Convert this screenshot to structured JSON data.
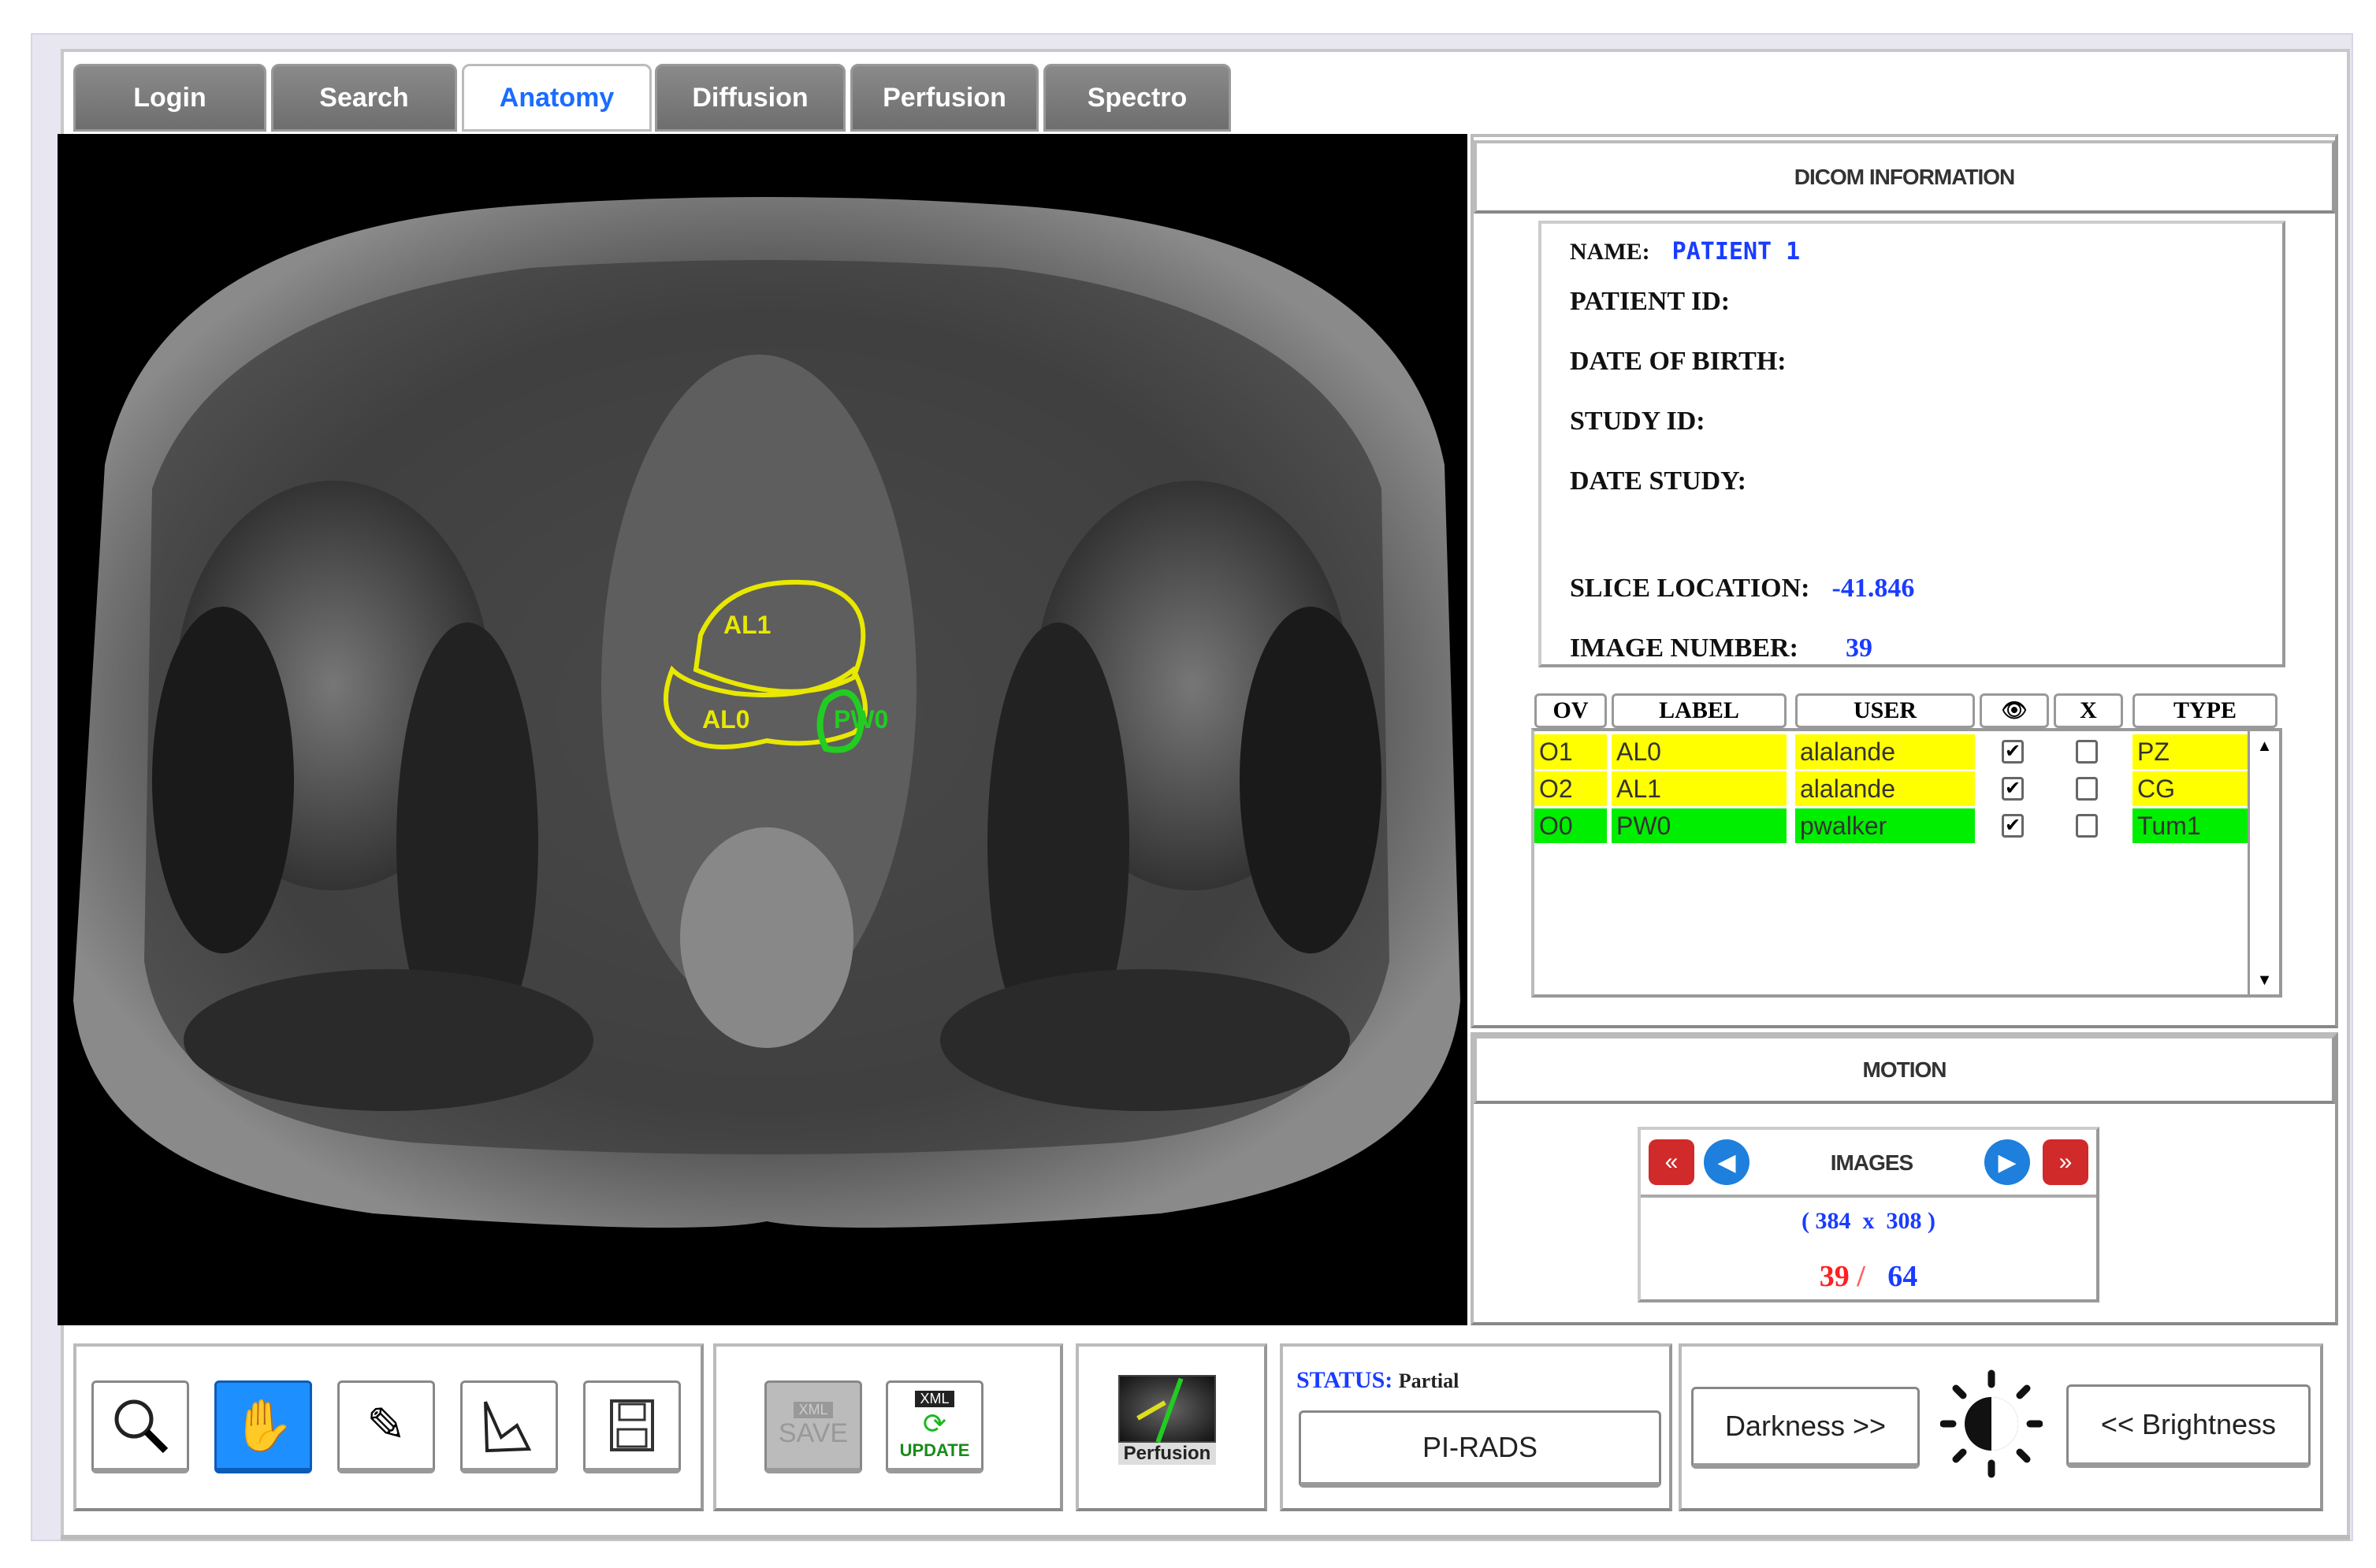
{
  "tabs": [
    {
      "label": "Login"
    },
    {
      "label": "Search"
    },
    {
      "label": "Anatomy",
      "active": true
    },
    {
      "label": "Diffusion"
    },
    {
      "label": "Perfusion"
    },
    {
      "label": "Spectro"
    }
  ],
  "viewer": {
    "contours": [
      {
        "label": "AL1",
        "color": "#e8e800"
      },
      {
        "label": "AL0",
        "color": "#e8e800"
      },
      {
        "label": "PW0",
        "color": "#22cc22"
      }
    ]
  },
  "dicom": {
    "title": "DICOM INFORMATION",
    "name_label": "NAME:",
    "name_value": "PATIENT 1",
    "patient_id_label": "PATIENT ID:",
    "dob_label": "DATE OF BIRTH:",
    "study_id_label": "STUDY ID:",
    "date_study_label": "DATE STUDY:",
    "slice_location_label": "SLICE LOCATION:",
    "slice_location_value": "-41.846",
    "image_number_label": "IMAGE NUMBER:",
    "image_number_value": "39"
  },
  "table": {
    "headers": {
      "ov": "OV",
      "label": "LABEL",
      "user": "USER",
      "visible_icon": "eye-icon",
      "delete_icon": "X",
      "type": "TYPE"
    },
    "rows": [
      {
        "ov": "O1",
        "label": "AL0",
        "user": "alalande",
        "visible": true,
        "delete": false,
        "type": "PZ",
        "color": "#ffff00"
      },
      {
        "ov": "O2",
        "label": "AL1",
        "user": "alalande",
        "visible": true,
        "delete": false,
        "type": "CG",
        "color": "#ffff00"
      },
      {
        "ov": "O0",
        "label": "PW0",
        "user": "pwalker",
        "visible": true,
        "delete": false,
        "type": "Tum1",
        "color": "#00ee00"
      }
    ]
  },
  "motion": {
    "title": "MOTION",
    "images_label": "IMAGES",
    "dimensions": "( 384  x  308 )",
    "current": "39",
    "separator": "/",
    "total": "64"
  },
  "toolbar": {
    "save_label": "SAVE",
    "update_label": "UPDATE",
    "xml_label": "XML",
    "perfusion_label": "Perfusion",
    "status_label": "STATUS:",
    "status_value": "Partial",
    "pirads_label": "PI-RADS",
    "darkness_label": "Darkness >>",
    "brightness_label": "<< Brightness"
  },
  "colors": {
    "accent": "#1a6cff",
    "active_tool": "#1e8fff",
    "roi_yellow": "#ffff00",
    "roi_green": "#00ee00",
    "current_red": "#ff2020"
  }
}
